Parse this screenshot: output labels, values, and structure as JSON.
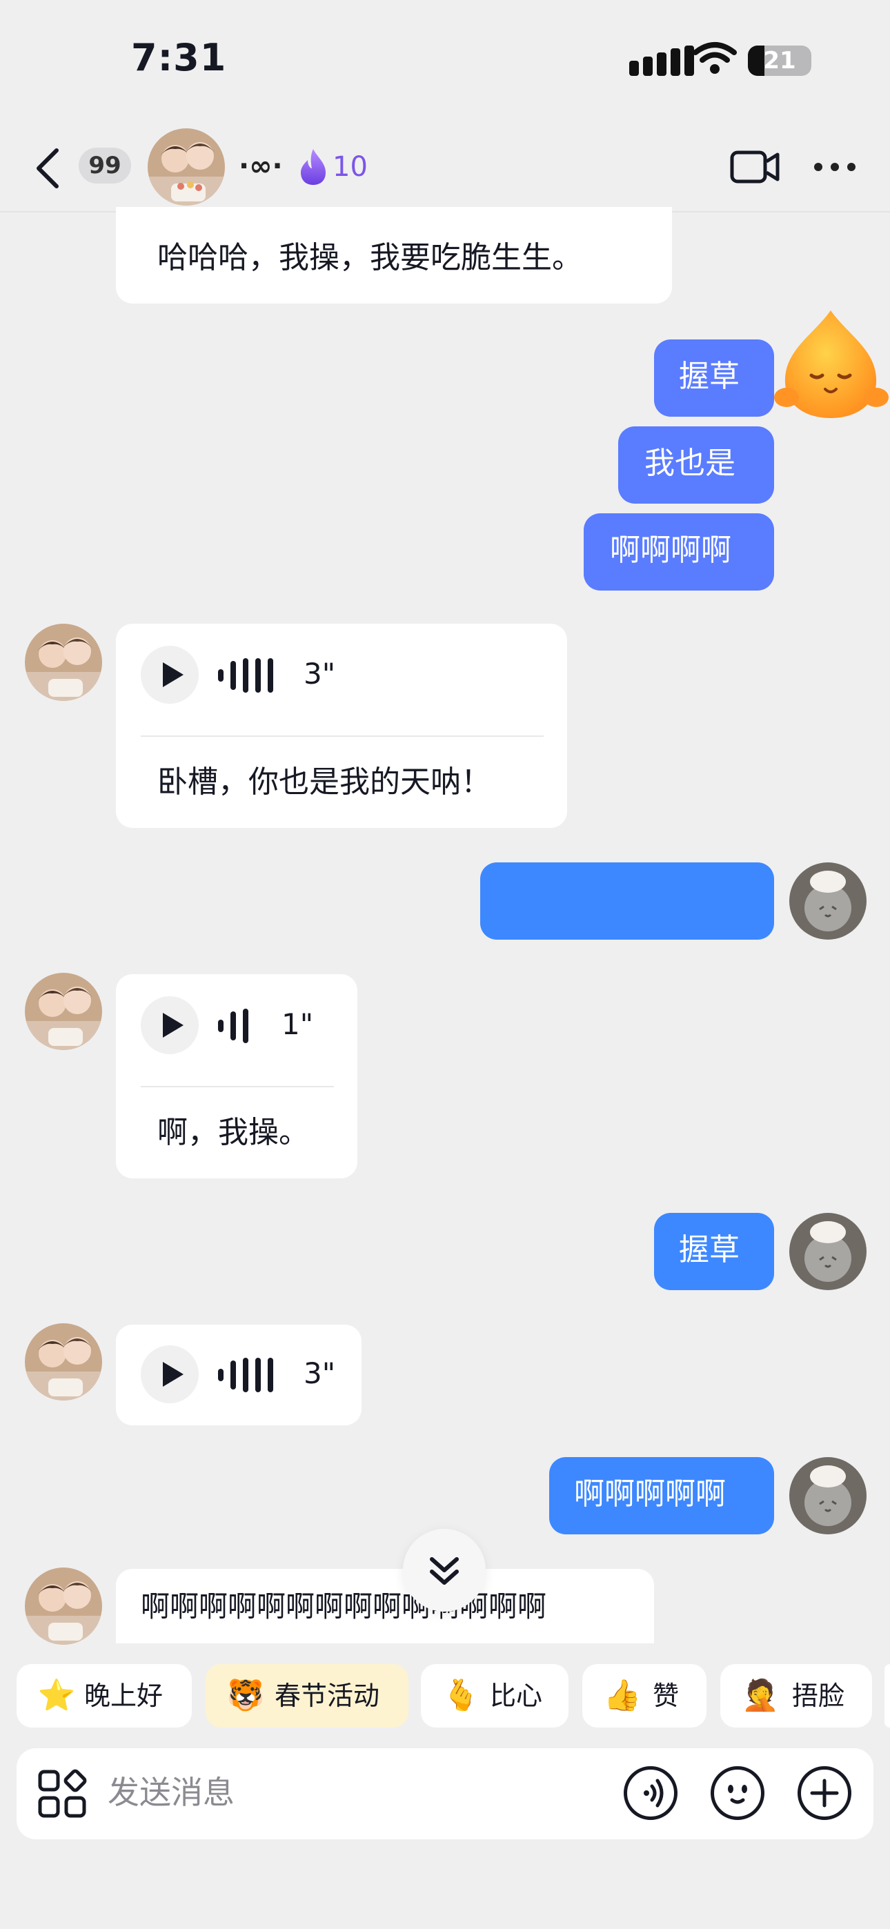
{
  "status_bar": {
    "time": "7:31",
    "battery": "21"
  },
  "header": {
    "unread_count": "99",
    "infinity": "∙∞∙",
    "spark_count": "10"
  },
  "messages": {
    "m1": "哈哈哈，我操，我要吃脆生生。",
    "m2": "握草",
    "m3": "我也是",
    "m4": "啊啊啊啊",
    "m5_duration": "3\"",
    "m5_text": "卧槽，你也是我的天呐！",
    "m6_text": "",
    "m7_duration": "1\"",
    "m7_text": "啊，我操。",
    "m8": "握草",
    "m9_duration": "3\"",
    "m10": "啊啊啊啊啊",
    "m11": "啊啊啊啊啊啊啊啊啊啊啊啊啊啊"
  },
  "quick_replies": [
    {
      "label": "晚上好",
      "emoji": "⭐"
    },
    {
      "label": "春节活动",
      "emoji": "🐯"
    },
    {
      "label": "比心",
      "emoji": "🫰"
    },
    {
      "label": "赞",
      "emoji": "👍"
    },
    {
      "label": "捂脸",
      "emoji": "🤦"
    }
  ],
  "input": {
    "placeholder": "发送消息"
  },
  "colors": {
    "outgoing_bubble": "#5a7cff",
    "outgoing_bubble_alt": "#3d88ff",
    "spark": "#7b55e8",
    "background": "#efeff0"
  }
}
